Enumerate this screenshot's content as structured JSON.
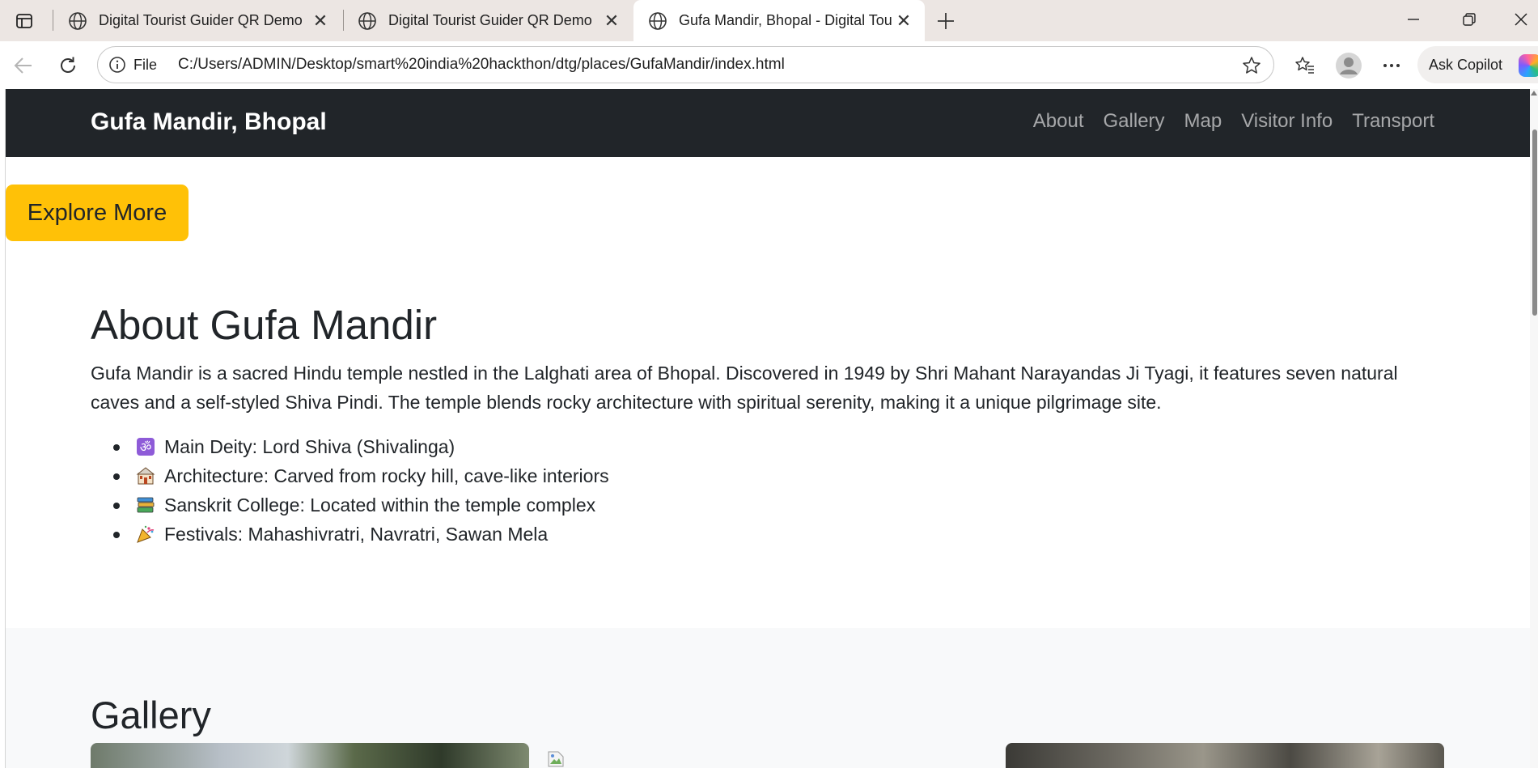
{
  "browser": {
    "tabs": [
      {
        "title": "Digital Tourist Guider QR Demo"
      },
      {
        "title": "Digital Tourist Guider QR Demo"
      },
      {
        "title": "Gufa Mandir, Bhopal - Digital Tou"
      }
    ],
    "address": {
      "scheme_label": "File",
      "url": "C:/Users/ADMIN/Desktop/smart%20india%20hackthon/dtg/places/GufaMandir/index.html"
    },
    "copilot_label": "Ask Copilot"
  },
  "site": {
    "brand": "Gufa Mandir, Bhopal",
    "nav": [
      "About",
      "Gallery",
      "Map",
      "Visitor Info",
      "Transport"
    ],
    "explore_button": "Explore More",
    "about": {
      "title": "About Gufa Mandir",
      "description": "Gufa Mandir is a sacred Hindu temple nestled in the Lalghati area of Bhopal. Discovered in 1949 by Shri Mahant Narayandas Ji Tyagi, it features seven natural caves and a self-styled Shiva Pindi. The temple blends rocky architecture with spiritual serenity, making it a unique pilgrimage site.",
      "highlights": [
        {
          "icon": "om-icon",
          "text": "Main Deity: Lord Shiva (Shivalinga)"
        },
        {
          "icon": "temple-icon",
          "text": "Architecture: Carved from rocky hill, cave-like interiors"
        },
        {
          "icon": "books-icon",
          "text": "Sanskrit College: Located within the temple complex"
        },
        {
          "icon": "party-popper-icon",
          "text": "Festivals: Mahashivratri, Navratri, Sawan Mela"
        }
      ]
    },
    "gallery": {
      "title": "Gallery"
    }
  },
  "colors": {
    "navbar": "#212529",
    "accent": "#ffc107",
    "gallery_bg": "#f8f9fa",
    "tabstrip": "#ece6e3"
  }
}
